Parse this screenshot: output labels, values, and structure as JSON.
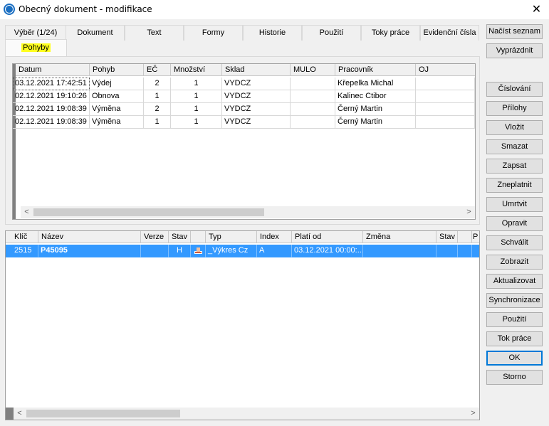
{
  "window": {
    "title": "Obecný dokument - modifikace",
    "close_glyph": "✕"
  },
  "tabs_row1": [
    "Výběr (1/24)",
    "Dokument",
    "Text",
    "Formy",
    "Historie",
    "Použití",
    "Toky práce",
    "Evidenční čísla"
  ],
  "tabs_row2": [
    "Pohyby"
  ],
  "movements": {
    "columns": [
      "Datum",
      "Pohyb",
      "EČ",
      "Množství",
      "Sklad",
      "MULO",
      "Pracovník",
      "OJ"
    ],
    "rows": [
      [
        "03.12.2021 17:42:51",
        "Výdej",
        "2",
        "1",
        "VYDCZ",
        "",
        "Křepelka Michal",
        ""
      ],
      [
        "02.12.2021 19:10:26",
        "Obnova",
        "1",
        "1",
        "VYDCZ",
        "",
        "Kalinec Ctibor",
        ""
      ],
      [
        "02.12.2021 19:08:39",
        "Výměna",
        "2",
        "1",
        "VYDCZ",
        "",
        "Černý Martin",
        ""
      ],
      [
        "02.12.2021 19:08:39",
        "Výměna",
        "1",
        "1",
        "VYDCZ",
        "",
        "Černý Martin",
        ""
      ]
    ]
  },
  "documents": {
    "columns": [
      "Klíč",
      "Název",
      "Verze",
      "Stav",
      "",
      "Typ",
      "Index",
      "Platí od",
      "Změna",
      "Stav",
      "",
      "P"
    ],
    "rows": [
      [
        "2515",
        "P45095",
        "",
        "H",
        "",
        "_Výkres Cz",
        "A",
        "03.12.2021 00:00:...",
        "",
        "",
        "",
        ""
      ]
    ]
  },
  "buttons": {
    "nacist": "Načíst seznam",
    "vyprazdnit": "Vyprázdnit",
    "cislovani": "Číslování",
    "prilohy": "Přílohy",
    "vlozit": "Vložit",
    "smazat": "Smazat",
    "zapsat": "Zapsat",
    "zneplatnit": "Zneplatnit",
    "umrtvit": "Umrtvit",
    "opravit": "Opravit",
    "schvalit": "Schválit",
    "zobrazit": "Zobrazit",
    "aktualizovat": "Aktualizovat",
    "synchronizace": "Synchronizace",
    "pouziti": "Použití",
    "tok_prace": "Tok práce",
    "ok": "OK",
    "storno": "Storno"
  },
  "scroll": {
    "left_arrow": "<",
    "right_arrow": ">"
  }
}
